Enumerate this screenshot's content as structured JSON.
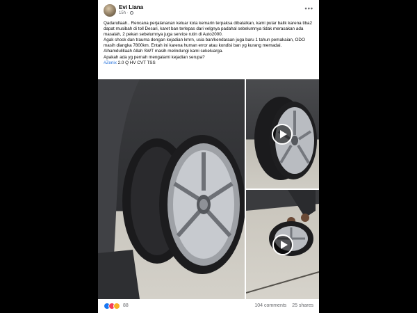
{
  "post": {
    "author": "Evi Liana",
    "time": "15h",
    "menu_icon": "more-dots-icon",
    "text_lines": [
      "Qadarullaah.. Rencana perjalananan keluar kota kemarin terpaksa dibatalkan, kami putar balik karena tiba2 dapat musibah di toll Desari, karet ban terlepas dari velgnya padahal sebelumnya tidak merasakan ada masalah, 2 pekan sebelumnya juga service rutin di Auto2000.",
      "Agak shock dan trauma dengan kejadian kmrn, usia ban/kendaraan juga baru 1 tahun pemakaian, ODO masih diangka 7800km. Entah ini karena human error atau kondisi ban yg kurang memadai.",
      "Alhamdulillaah Allah SWT masih melindungi kami sekeluarga.",
      "Apakah ada yg pernah mengalami kejadian serupa?"
    ],
    "hashtag": "#Zenix",
    "hashtag_suffix": " 2.0 Q HV CVT TSS"
  },
  "footer": {
    "reaction_count": "88",
    "comments": "104 comments",
    "shares": "25 shares"
  },
  "colors": {
    "link": "#216fdb",
    "muted": "#65676b",
    "like": "#1877f2",
    "love": "#f33e58",
    "haha": "#f7b125"
  }
}
